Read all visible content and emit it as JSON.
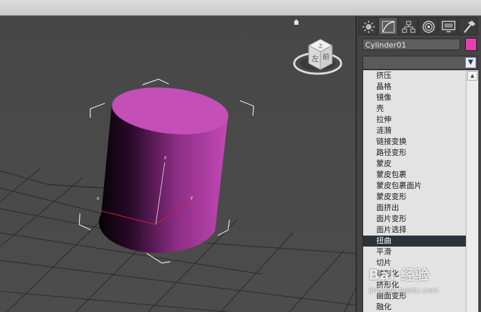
{
  "colors": {
    "object_color": "#e040b4",
    "viewport_bg": "#4a4a4a",
    "list_bg": "#e3e3e3",
    "selected_bg": "#2b323b"
  },
  "viewport": {
    "viewcube_top": "上",
    "viewcube_front": "前",
    "viewcube_left": "左"
  },
  "command_panel": {
    "tabs": [
      {
        "name": "create-tab",
        "icon": "sun-icon"
      },
      {
        "name": "modify-tab",
        "icon": "modify-curve-icon"
      },
      {
        "name": "hierarchy-tab",
        "icon": "hierarchy-icon"
      },
      {
        "name": "motion-tab",
        "icon": "motion-circle-icon"
      },
      {
        "name": "display-tab",
        "icon": "monitor-icon"
      },
      {
        "name": "utilities-tab",
        "icon": "hammer-icon"
      }
    ],
    "object_name": "Cylinder01",
    "modifier_list_value": "",
    "modifier_items": [
      "挤压",
      "晶格",
      "镜像",
      "壳",
      "拉伸",
      "涟漪",
      "链接变换",
      "路径变形",
      "蒙皮",
      "蒙皮包裹",
      "蒙皮包裹面片",
      "蒙皮变形",
      "面挤出",
      "面片变形",
      "面片选择",
      "扭曲",
      "平滑",
      "切片",
      "球形化",
      "挤形化",
      "曲面变形",
      "融化"
    ],
    "selected_index": 15
  },
  "watermark": {
    "main": "Bai 经验",
    "sub": "jingyan.baidu.com"
  }
}
